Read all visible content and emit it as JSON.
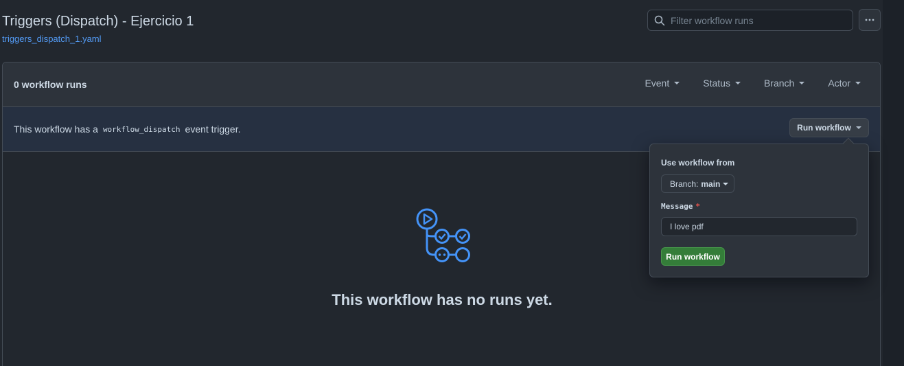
{
  "header": {
    "title": "Triggers (Dispatch) - Ejercicio 1",
    "file": "triggers_dispatch_1.yaml",
    "search_placeholder": "Filter workflow runs",
    "more_icon": "kebab-horizontal-icon"
  },
  "runs": {
    "count_label": "0 workflow runs",
    "filters": [
      "Event",
      "Status",
      "Branch",
      "Actor"
    ]
  },
  "dispatch": {
    "prefix": "This workflow has a",
    "code": "workflow_dispatch",
    "suffix": "event trigger.",
    "run_button": "Run workflow"
  },
  "empty_state": {
    "title": "This workflow has no runs yet.",
    "icon": "workflow-icon"
  },
  "popover": {
    "heading": "Use workflow from",
    "branch_prefix": "Branch:",
    "branch_value": "main",
    "message_label": "Message",
    "required_marker": "*",
    "message_value": "I love pdf",
    "submit": "Run workflow"
  },
  "colors": {
    "accent": "#539bf5",
    "success": "#347d39",
    "background": "#22272e",
    "danger": "#e5534b"
  }
}
